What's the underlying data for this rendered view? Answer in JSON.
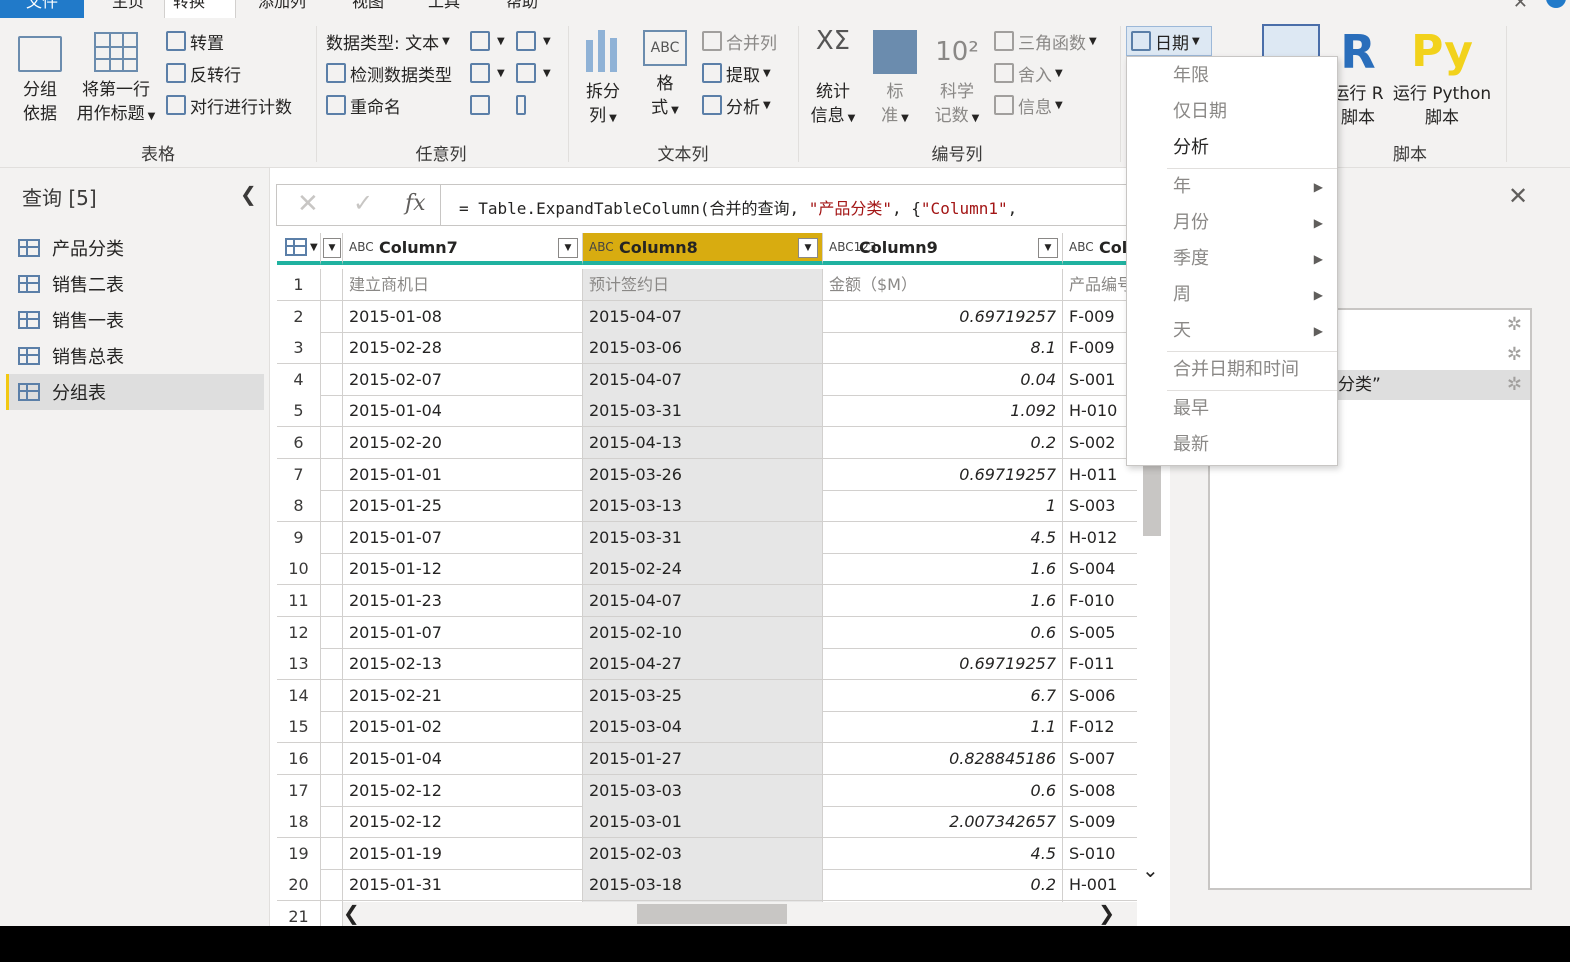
{
  "tabs": [
    {
      "label": "文件"
    },
    {
      "label": "主页"
    },
    {
      "label": "转换"
    },
    {
      "label": "添加列"
    },
    {
      "label": "视图"
    },
    {
      "label": "工具"
    },
    {
      "label": "帮助"
    }
  ],
  "ribbon": {
    "table_group": {
      "label": "表格",
      "group_by": "分组\n依据",
      "group_by_l1": "分组",
      "group_by_l2": "依据",
      "use_first_row_l1": "将第一行",
      "use_first_row_l2": "用作标题",
      "transpose": "转置",
      "reverse_rows": "反转行",
      "count_rows": "对行进行计数"
    },
    "any_column": {
      "label": "任意列",
      "data_type": "数据类型: 文本",
      "detect_type": "检测数据类型",
      "rename": "重命名"
    },
    "text_column": {
      "label": "文本列",
      "split_l1": "拆分",
      "split_l2": "列",
      "format_l1": "格",
      "format_l2": "式",
      "merge": "合并列",
      "extract": "提取",
      "parse": "分析"
    },
    "number_column": {
      "label": "编号列",
      "stats_l1": "统计",
      "stats_l2": "信息",
      "standard_l1": "标",
      "standard_l2": "准",
      "sci_l1": "科学",
      "sci_l2": "记数",
      "trig": "三角函数",
      "round": "舍入",
      "info": "信息",
      "sci_glyph": "10²"
    },
    "date_button": "日期",
    "script_group": {
      "label": "脚本",
      "run_r_l1": "运行 R",
      "run_r_l2": "脚本",
      "run_py_l1": "运行 Python",
      "run_py_l2": "脚本"
    }
  },
  "queries": {
    "title": "查询 [5]",
    "items": [
      "产品分类",
      "销售二表",
      "销售一表",
      "销售总表",
      "分组表"
    ],
    "selected_index": 4
  },
  "formula": {
    "prefix": "= Table.ExpandTableColumn(合并的查询, ",
    "arg1": "\"产品分类\"",
    "mid": ", {",
    "arg2": "\"Column1\"",
    "tail": ","
  },
  "grid": {
    "columns": [
      {
        "name": "Column7",
        "type": "ABC"
      },
      {
        "name": "Column8",
        "type": "ABC"
      },
      {
        "name": "Column9",
        "type": "ABC123"
      },
      {
        "name": "Col",
        "type": "ABC"
      }
    ],
    "rows": [
      [
        "1",
        "建立商机日",
        "预计签约日",
        "金额（$M）",
        "产品编号"
      ],
      [
        "2",
        "2015-01-08",
        "2015-04-07",
        "0.69719257",
        "F-009"
      ],
      [
        "3",
        "2015-02-28",
        "2015-03-06",
        "8.1",
        "F-009"
      ],
      [
        "4",
        "2015-02-07",
        "2015-04-07",
        "0.04",
        "S-001"
      ],
      [
        "5",
        "2015-01-04",
        "2015-03-31",
        "1.092",
        "H-010"
      ],
      [
        "6",
        "2015-02-20",
        "2015-04-13",
        "0.2",
        "S-002"
      ],
      [
        "7",
        "2015-01-01",
        "2015-03-26",
        "0.69719257",
        "H-011"
      ],
      [
        "8",
        "2015-01-25",
        "2015-03-13",
        "1",
        "S-003"
      ],
      [
        "9",
        "2015-01-07",
        "2015-03-31",
        "4.5",
        "H-012"
      ],
      [
        "10",
        "2015-01-12",
        "2015-02-24",
        "1.6",
        "S-004"
      ],
      [
        "11",
        "2015-01-23",
        "2015-04-07",
        "1.6",
        "F-010"
      ],
      [
        "12",
        "2015-01-07",
        "2015-02-10",
        "0.6",
        "S-005"
      ],
      [
        "13",
        "2015-02-13",
        "2015-04-27",
        "0.69719257",
        "F-011"
      ],
      [
        "14",
        "2015-02-21",
        "2015-03-25",
        "6.7",
        "S-006"
      ],
      [
        "15",
        "2015-01-02",
        "2015-03-04",
        "1.1",
        "F-012"
      ],
      [
        "16",
        "2015-01-04",
        "2015-01-27",
        "0.828845186",
        "S-007"
      ],
      [
        "17",
        "2015-02-12",
        "2015-03-03",
        "0.6",
        "S-008"
      ],
      [
        "18",
        "2015-02-12",
        "2015-03-01",
        "2.007342657",
        "S-009"
      ],
      [
        "19",
        "2015-01-19",
        "2015-02-03",
        "4.5",
        "S-010"
      ],
      [
        "20",
        "2015-01-31",
        "2015-03-18",
        "0.2",
        "H-001"
      ],
      [
        "21",
        "",
        "",
        "",
        ""
      ]
    ]
  },
  "steps": {
    "visible_step_text": "分类”"
  },
  "date_menu": {
    "items": [
      {
        "label": "年限",
        "enabled": false,
        "submenu": false
      },
      {
        "label": "仅日期",
        "enabled": false,
        "submenu": false
      },
      {
        "label": "分析",
        "enabled": true,
        "submenu": false
      },
      {
        "label": "年",
        "enabled": false,
        "submenu": true
      },
      {
        "label": "月份",
        "enabled": false,
        "submenu": true
      },
      {
        "label": "季度",
        "enabled": false,
        "submenu": true
      },
      {
        "label": "周",
        "enabled": false,
        "submenu": true
      },
      {
        "label": "天",
        "enabled": false,
        "submenu": true
      },
      {
        "label": "合并日期和时间",
        "enabled": false,
        "submenu": false
      },
      {
        "label": "最早",
        "enabled": false,
        "submenu": false
      },
      {
        "label": "最新",
        "enabled": false,
        "submenu": false
      }
    ]
  },
  "colors": {
    "accent": "#217ac9",
    "selected_column": "#d8ac10",
    "header_underline": "#20b2a0",
    "selected_query_bar": "#f2c811"
  }
}
